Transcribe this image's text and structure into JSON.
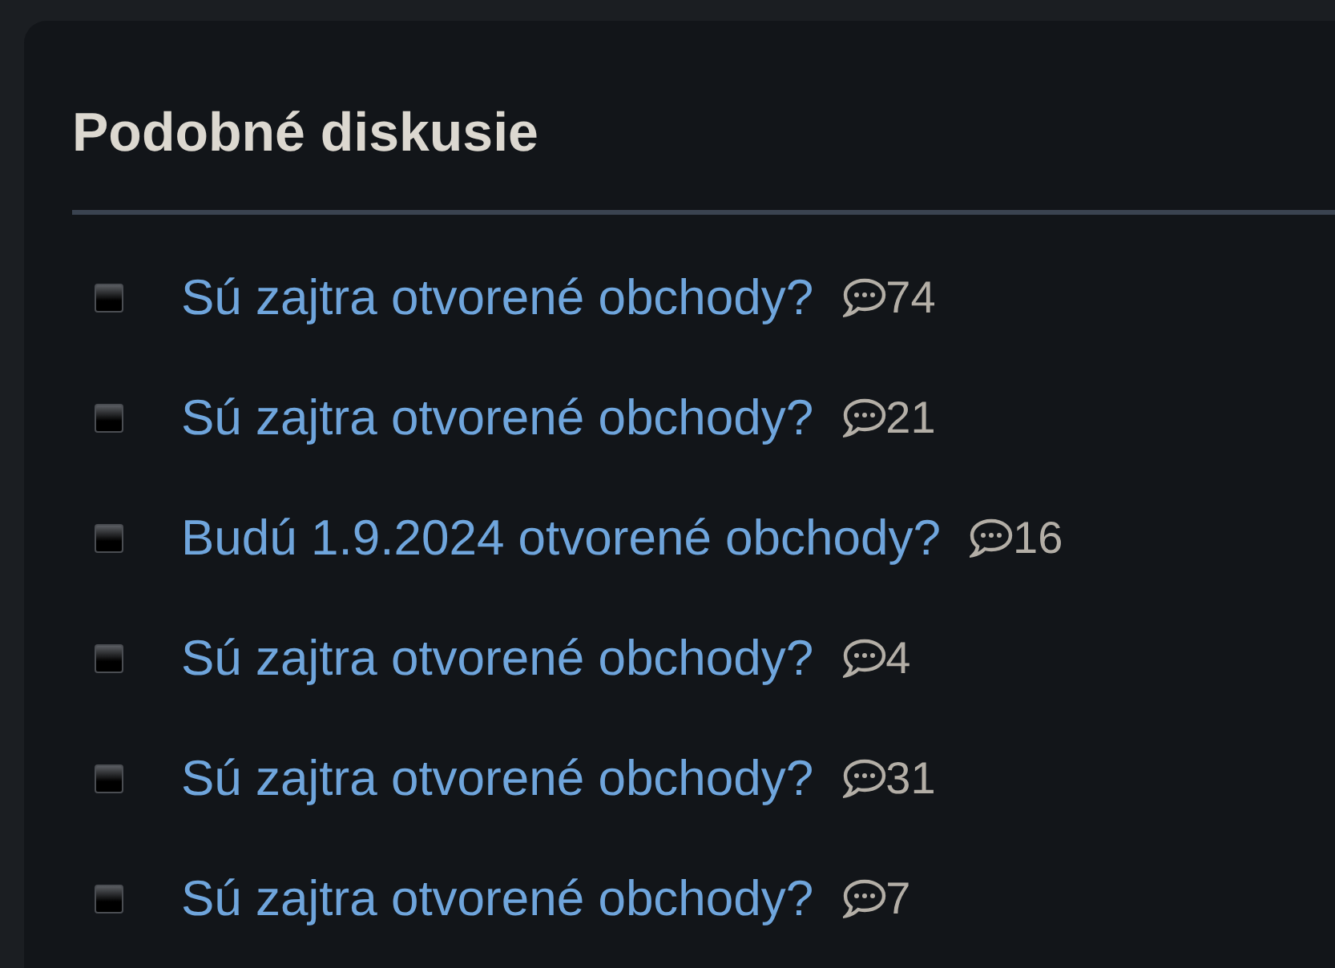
{
  "section": {
    "title": "Podobné diskusie"
  },
  "items": [
    {
      "title": "Sú zajtra otvorené obchody?",
      "comments": "74"
    },
    {
      "title": "Sú zajtra otvorené obchody?",
      "comments": "21"
    },
    {
      "title": "Budú 1.9.2024 otvorené obchody?",
      "comments": "16"
    },
    {
      "title": "Sú zajtra otvorené obchody?",
      "comments": "4"
    },
    {
      "title": "Sú zajtra otvorené obchody?",
      "comments": "31"
    },
    {
      "title": "Sú zajtra otvorené obchody?",
      "comments": "7"
    }
  ]
}
